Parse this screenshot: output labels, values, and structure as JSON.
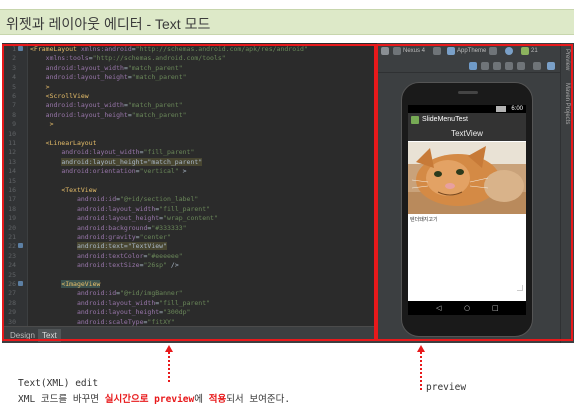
{
  "page": {
    "title": "위젯과 레이아웃 에디터 - Text 모드"
  },
  "editor": {
    "lines": [
      {
        "n": "1",
        "parts": [
          [
            "tag",
            "<FrameLayout "
          ],
          [
            "attr",
            "xmlns:android"
          ],
          [
            "plain",
            "="
          ],
          [
            "val",
            "\"http://schemas.android.com/apk/res/android\""
          ]
        ]
      },
      {
        "n": "2",
        "parts": [
          [
            "plain",
            "    "
          ],
          [
            "attr",
            "xmlns:tools"
          ],
          [
            "plain",
            "="
          ],
          [
            "val",
            "\"http://schemas.android.com/tools\""
          ]
        ]
      },
      {
        "n": "3",
        "parts": [
          [
            "plain",
            "    "
          ],
          [
            "attr",
            "android:layout_width"
          ],
          [
            "plain",
            "="
          ],
          [
            "val",
            "\"match_parent\""
          ]
        ]
      },
      {
        "n": "4",
        "parts": [
          [
            "plain",
            "    "
          ],
          [
            "attr",
            "android:layout_height"
          ],
          [
            "plain",
            "="
          ],
          [
            "val",
            "\"match_parent\""
          ]
        ]
      },
      {
        "n": "5",
        "parts": [
          [
            "plain",
            "    "
          ],
          [
            "tag",
            ">"
          ]
        ]
      },
      {
        "n": "6",
        "parts": [
          [
            "plain",
            "    "
          ],
          [
            "tag",
            "<ScrollView"
          ]
        ]
      },
      {
        "n": "7",
        "parts": [
          [
            "plain",
            "    "
          ],
          [
            "attr",
            "android:layout_width"
          ],
          [
            "plain",
            "="
          ],
          [
            "val",
            "\"match_parent\""
          ]
        ]
      },
      {
        "n": "8",
        "parts": [
          [
            "plain",
            "    "
          ],
          [
            "attr",
            "android:layout_height"
          ],
          [
            "plain",
            "="
          ],
          [
            "val",
            "\"match_parent\""
          ]
        ]
      },
      {
        "n": "9",
        "parts": [
          [
            "plain",
            "     "
          ],
          [
            "tag",
            ">"
          ]
        ]
      },
      {
        "n": "10",
        "parts": []
      },
      {
        "n": "11",
        "parts": [
          [
            "plain",
            "    "
          ],
          [
            "tag",
            "<LinearLayout"
          ]
        ]
      },
      {
        "n": "12",
        "parts": [
          [
            "plain",
            "        "
          ],
          [
            "attr",
            "android:layout_width"
          ],
          [
            "plain",
            "="
          ],
          [
            "val",
            "\"fill_parent\""
          ]
        ]
      },
      {
        "n": "13",
        "parts": [
          [
            "plain",
            "        "
          ],
          [
            "hl",
            "android:layout_height=\"match_parent\""
          ]
        ]
      },
      {
        "n": "14",
        "parts": [
          [
            "plain",
            "        "
          ],
          [
            "attr",
            "android:orientation"
          ],
          [
            "plain",
            "="
          ],
          [
            "val",
            "\"vertical\""
          ],
          [
            "plain",
            " >"
          ]
        ]
      },
      {
        "n": "15",
        "parts": []
      },
      {
        "n": "16",
        "parts": [
          [
            "plain",
            "        "
          ],
          [
            "tag",
            "<TextView"
          ]
        ]
      },
      {
        "n": "17",
        "parts": [
          [
            "plain",
            "            "
          ],
          [
            "attr",
            "android:id"
          ],
          [
            "plain",
            "="
          ],
          [
            "val",
            "\"@+id/section_label\""
          ]
        ]
      },
      {
        "n": "18",
        "parts": [
          [
            "plain",
            "            "
          ],
          [
            "attr",
            "android:layout_width"
          ],
          [
            "plain",
            "="
          ],
          [
            "val",
            "\"fill_parent\""
          ]
        ]
      },
      {
        "n": "19",
        "parts": [
          [
            "plain",
            "            "
          ],
          [
            "attr",
            "android:layout_height"
          ],
          [
            "plain",
            "="
          ],
          [
            "val",
            "\"wrap_content\""
          ]
        ]
      },
      {
        "n": "20",
        "parts": [
          [
            "plain",
            "            "
          ],
          [
            "attr",
            "android:background"
          ],
          [
            "plain",
            "="
          ],
          [
            "val",
            "\"#333333\""
          ]
        ]
      },
      {
        "n": "21",
        "parts": [
          [
            "plain",
            "            "
          ],
          [
            "attr",
            "android:gravity"
          ],
          [
            "plain",
            "="
          ],
          [
            "val",
            "\"center\""
          ]
        ]
      },
      {
        "n": "22",
        "parts": [
          [
            "plain",
            "            "
          ],
          [
            "hl",
            "android:text=\"TextView\""
          ]
        ]
      },
      {
        "n": "23",
        "parts": [
          [
            "plain",
            "            "
          ],
          [
            "attr",
            "android:textColor"
          ],
          [
            "plain",
            "="
          ],
          [
            "val",
            "\"#eeeeee\""
          ]
        ]
      },
      {
        "n": "24",
        "parts": [
          [
            "plain",
            "            "
          ],
          [
            "attr",
            "android:textSize"
          ],
          [
            "plain",
            "="
          ],
          [
            "val",
            "\"26sp\""
          ],
          [
            "plain",
            " />"
          ]
        ]
      },
      {
        "n": "25",
        "parts": []
      },
      {
        "n": "26",
        "parts": [
          [
            "plain",
            "        "
          ],
          [
            "hltag",
            "<ImageView"
          ]
        ]
      },
      {
        "n": "27",
        "parts": [
          [
            "plain",
            "            "
          ],
          [
            "attr",
            "android:id"
          ],
          [
            "plain",
            "="
          ],
          [
            "val",
            "\"@+id/imgBanner\""
          ]
        ]
      },
      {
        "n": "28",
        "parts": [
          [
            "plain",
            "            "
          ],
          [
            "attr",
            "android:layout_width"
          ],
          [
            "plain",
            "="
          ],
          [
            "val",
            "\"fill_parent\""
          ]
        ]
      },
      {
        "n": "29",
        "parts": [
          [
            "plain",
            "            "
          ],
          [
            "attr",
            "android:layout_height"
          ],
          [
            "plain",
            "="
          ],
          [
            "val",
            "\"300dp\""
          ]
        ]
      },
      {
        "n": "30",
        "parts": [
          [
            "plain",
            "            "
          ],
          [
            "attr",
            "android:scaleType"
          ],
          [
            "plain",
            "="
          ],
          [
            "val",
            "\"fitXY\""
          ]
        ]
      }
    ],
    "tabs": [
      "Design",
      "Text"
    ]
  },
  "preview": {
    "toolbar": {
      "device": "Nexus 4",
      "theme": "AppTheme",
      "api": "21"
    },
    "side_labels": [
      "Preview",
      "Maven Projects"
    ],
    "app_title": "SlideMenuTest",
    "textview": "TextView",
    "caption": "텐더돼지고기",
    "clock": "6:00"
  },
  "annotations": {
    "left_title": "Text(XML) edit",
    "left_prefix": "XML 코드를 바꾸면 ",
    "left_strong1": "실시간으로 preview",
    "left_mid": "에 ",
    "left_strong2": "적용",
    "left_suffix": "되서 보여준다.",
    "right_label": "preview"
  },
  "colors": {
    "frame": "#e8191b",
    "title_bg": "#dde9c8"
  }
}
